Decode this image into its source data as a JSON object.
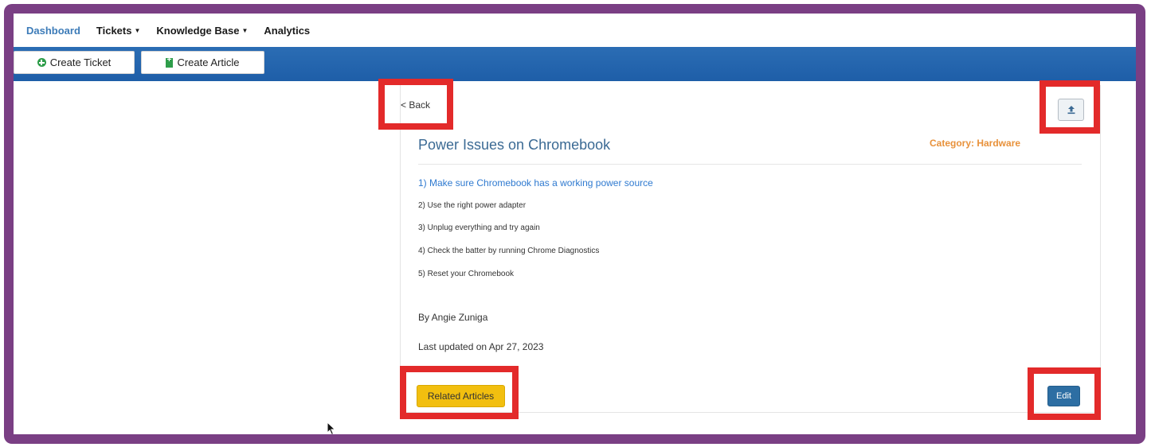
{
  "nav": {
    "items": [
      {
        "label": "Dashboard",
        "active": true
      },
      {
        "label": "Tickets",
        "dropdown": true
      },
      {
        "label": "Knowledge Base",
        "dropdown": true
      },
      {
        "label": "Analytics"
      }
    ]
  },
  "toolbar": {
    "create_ticket": "Create Ticket",
    "create_article": "Create Article"
  },
  "article": {
    "back_label": "< Back",
    "title": "Power Issues on Chromebook",
    "category": "Category: Hardware",
    "steps": [
      "1) Make sure Chromebook has a working power source",
      "2) Use the right power adapter",
      "3) Unplug everything and try again",
      "4) Check the batter by running Chrome Diagnostics",
      "5) Reset your Chromebook"
    ],
    "author": "By Angie Zuniga",
    "updated": "Last updated on Apr 27, 2023",
    "related_label": "Related Articles",
    "edit_label": "Edit"
  },
  "colors": {
    "frame": "#7a3f84",
    "toolbar": "#1e5ea8",
    "highlight": "#e32a2a",
    "related": "#f2bf0f",
    "edit": "#2d6ea3"
  },
  "icons": {
    "create_ticket": "plus-circle-icon",
    "create_article": "file-plus-icon",
    "upload": "upload-icon"
  }
}
